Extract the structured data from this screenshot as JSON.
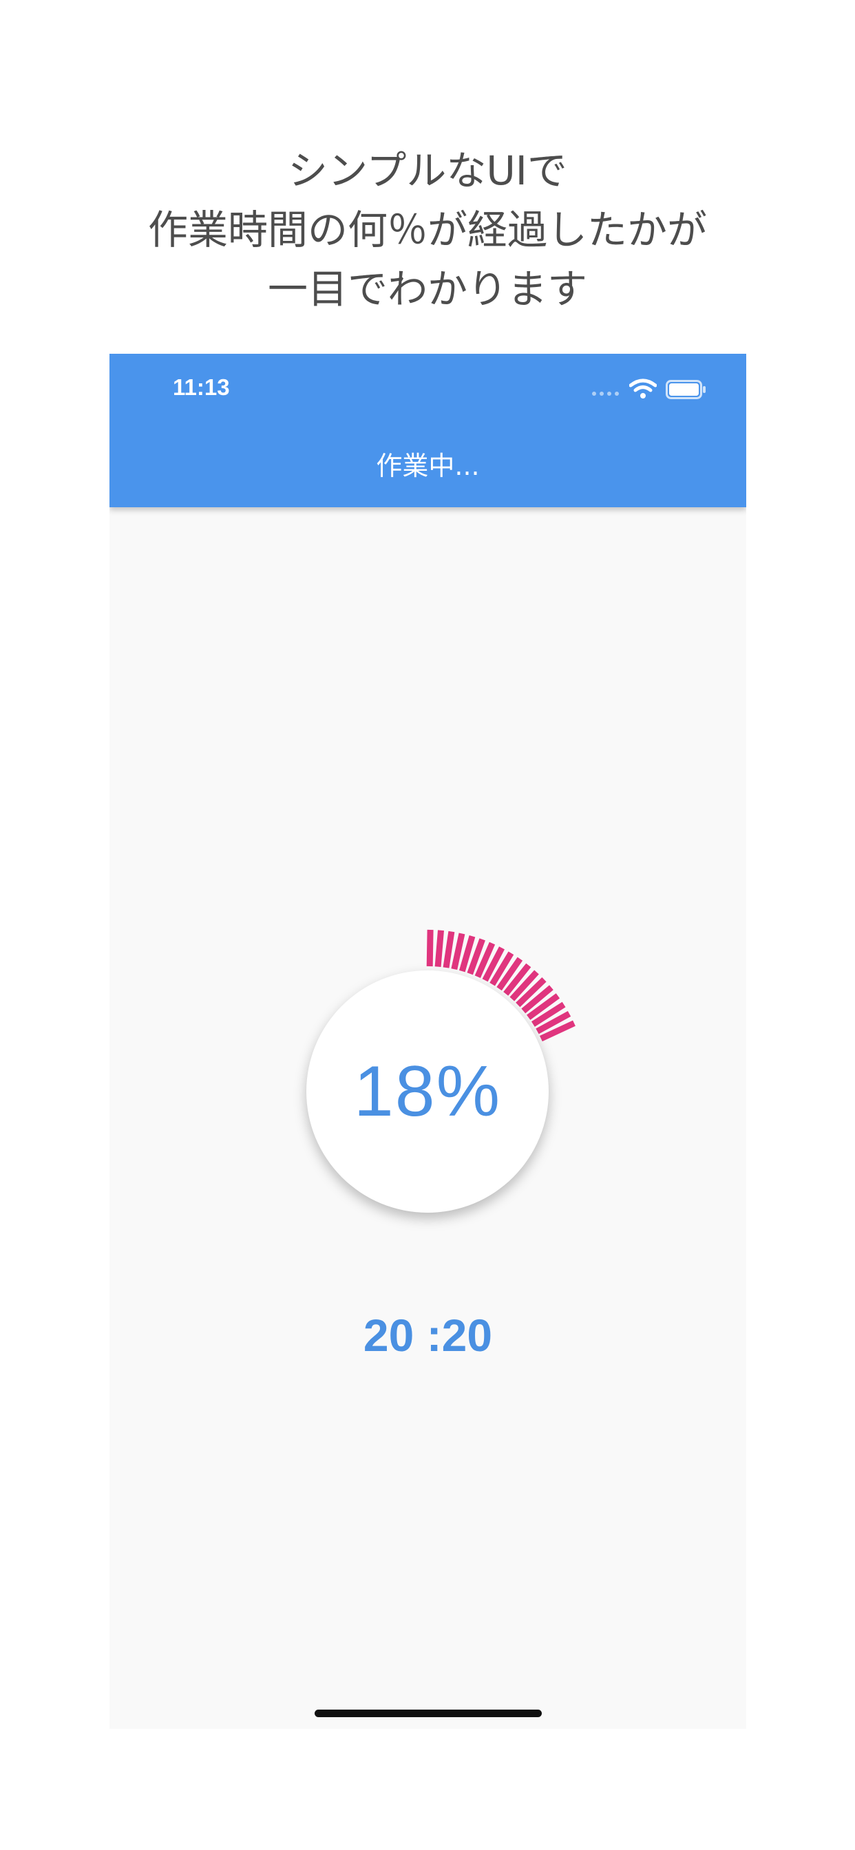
{
  "caption": {
    "line1": "シンプルなUIで",
    "line2": "作業時間の何％が経過したかが",
    "line3": "一目でわかります"
  },
  "status_bar": {
    "time": "11:13",
    "icons": [
      "signal-icon",
      "wifi-icon",
      "battery-icon"
    ]
  },
  "app_bar": {
    "title": "作業中..."
  },
  "progress": {
    "percent_label": "18%",
    "fraction": 0.18,
    "tick_color": "#e0357e"
  },
  "remaining_time": "20 :20",
  "colors": {
    "app_bar": "#4a94ec",
    "accent_text": "#4a90e2",
    "background": "#f9f9f9"
  }
}
